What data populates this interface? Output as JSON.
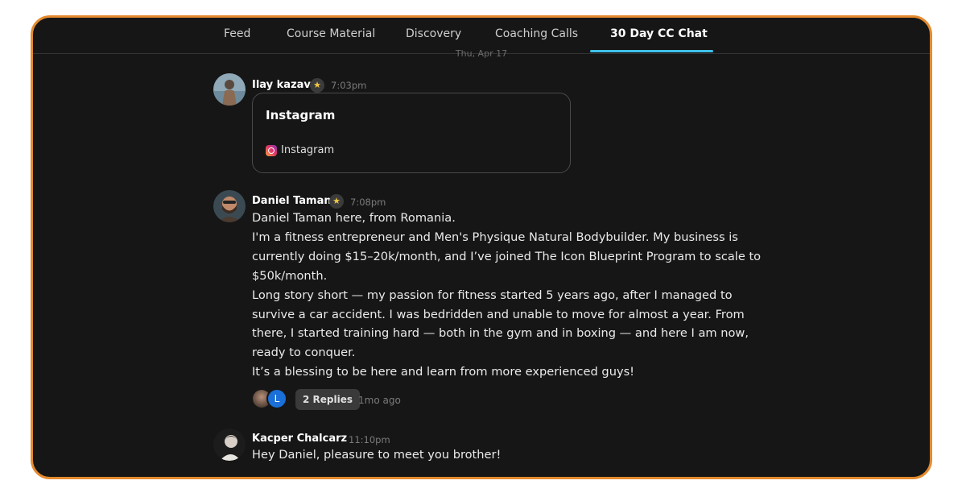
{
  "tabs": [
    {
      "label": "Feed"
    },
    {
      "label": "Course Material"
    },
    {
      "label": "Discovery"
    },
    {
      "label": "Coaching Calls"
    },
    {
      "label": "30 Day CC Chat",
      "active": true
    }
  ],
  "date_separator": "Thu, Apr 17",
  "messages": [
    {
      "author": "Ilay kazav",
      "badge": "star-icon",
      "time": "7:03pm",
      "card": {
        "title": "Instagram",
        "link_label": "Instagram",
        "link_icon": "instagram-icon"
      }
    },
    {
      "author": "Daniel Taman",
      "badge": "star-icon",
      "time": "7:08pm",
      "lines": [
        "Daniel Taman here, from Romania.",
        "I'm a fitness entrepreneur and Men's Physique Natural Bodybuilder. My business is currently doing $15–20k/month, and I’ve joined The Icon Blueprint Program to scale to $50k/month.",
        "Long story short — my passion for fitness started 5 years ago, after I managed to survive a car accident. I was bedridden and unable to move for almost a year. From there, I started training hard — both in the gym and in boxing — and here I am now, ready to conquer.",
        "It’s a blessing to be here and learn from more experienced guys!"
      ],
      "replies": {
        "avatar_letter": "L",
        "label": "2 Replies",
        "ago": "1mo ago"
      }
    },
    {
      "author": "Kacper Chalcarz",
      "time": "11:10pm",
      "lines": [
        "Hey Daniel, pleasure to meet you brother!"
      ]
    }
  ],
  "colors": {
    "frame_border": "#e48a2e",
    "background": "#161616",
    "tab_underline": "#3ec0e8",
    "badge_star": "#f2c744",
    "reply_avatar": "#1a6fd8"
  }
}
